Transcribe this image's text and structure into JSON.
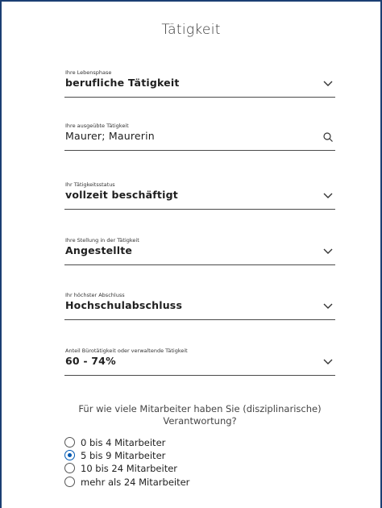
{
  "page": {
    "title": "Tätigkeit"
  },
  "fields": [
    {
      "label": "Ihre Lebensphase",
      "value": "berufliche Tätigkeit",
      "icon": "chevron-down-icon"
    },
    {
      "label": "Ihre ausgeübte Tätigkeit",
      "value": "Maurer; Maurerin",
      "icon": "search-icon"
    },
    {
      "label": "Ihr Tätigkeitsstatus",
      "value": "vollzeit beschäftigt",
      "icon": "chevron-down-icon"
    },
    {
      "label": "Ihre Stellung in der Tätigkeit",
      "value": "Angestellte",
      "icon": "chevron-down-icon"
    },
    {
      "label": "Ihr höchster Abschluss",
      "value": "Hochschulabschluss",
      "icon": "chevron-down-icon"
    },
    {
      "label": "Anteil Bürotätigkeit oder verwaltende Tätigkeit",
      "value": "60 - 74%",
      "icon": "chevron-down-icon"
    }
  ],
  "question": {
    "text": "Für wie viele Mitarbeiter haben Sie (disziplinarische) Verantwortung?",
    "options": [
      {
        "label": "0 bis 4 Mitarbeiter",
        "selected": false
      },
      {
        "label": "5 bis 9 Mitarbeiter",
        "selected": true
      },
      {
        "label": "10 bis 24 Mitarbeiter",
        "selected": false
      },
      {
        "label": "mehr als 24 Mitarbeiter",
        "selected": false
      }
    ]
  },
  "colors": {
    "frame": "#1b3f73",
    "accent": "#0059b3"
  }
}
